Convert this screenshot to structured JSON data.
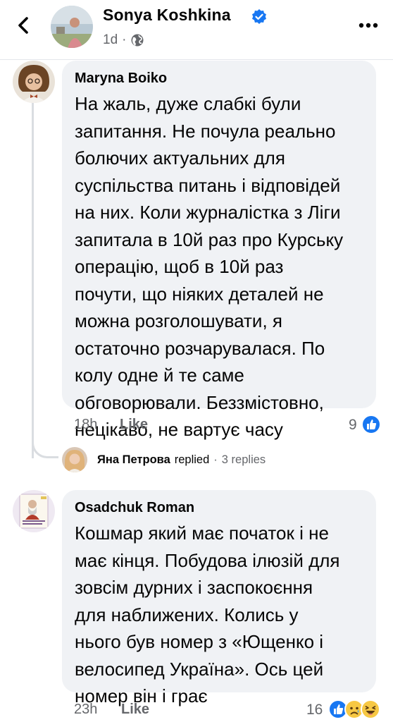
{
  "header": {
    "author_name": "Sonya Koshkina",
    "time": "1d",
    "separator": "·",
    "verified": true
  },
  "comments": [
    {
      "author": "Maryna Boiko",
      "text_lines": [
        "На жаль, дуже слабкі були",
        "запитання. Не почула реально",
        "болючих актуальних для",
        "суспільства питань і відповідей",
        "на них. Коли журналістка з Ліги",
        "запитала в 10й раз про Курську",
        "операцію, щоб в 10й раз",
        "почути, що ніяких деталей не",
        "можна розголошувати, я",
        "остаточно розчарувалася. По",
        "колу одне й те саме",
        "обговорювали. Беззмістовно,",
        "нецікаво, не вартує часу"
      ],
      "time": "18h",
      "like_label": "Like",
      "reaction_count": "9",
      "reactions": [
        "like-icon"
      ]
    },
    {
      "author": "Osadchuk Roman",
      "text_lines": [
        "Кошмар який має початок і не",
        "має кінця. Побудова ілюзій для",
        "зовсім дурних і заспокоєння",
        "для наближених. Колись у",
        "нього був номер з «Ющенко і",
        "велосипед Україна». Ось цей",
        "номер він і грає"
      ],
      "time": "23h",
      "like_label": "Like",
      "reaction_count": "16",
      "reactions": [
        "like-icon",
        "sad-icon",
        "haha-icon"
      ]
    }
  ],
  "reply_summary": {
    "name": "Яна Петрова",
    "action": "replied",
    "dot": "·",
    "count": "3 replies"
  },
  "colors": {
    "bubble": "#f0f2f5",
    "secondary_text": "#65676b",
    "like_blue": "#1877f2",
    "thread_line": "#dadde1"
  }
}
